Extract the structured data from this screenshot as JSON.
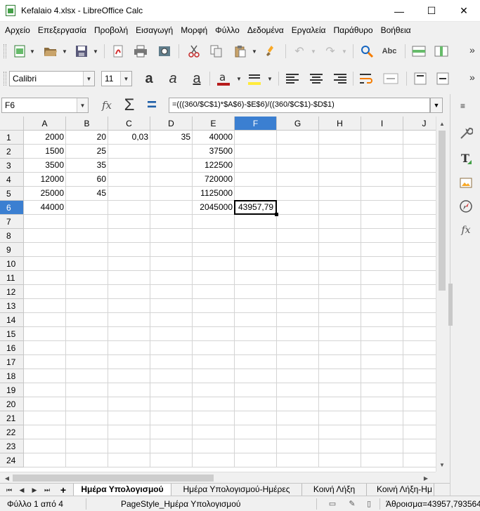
{
  "window": {
    "title": "Kefalaio 4.xlsx - LibreOffice Calc",
    "minimize": "—",
    "maximize": "☐",
    "close": "✕"
  },
  "menu": [
    "Αρχείο",
    "Επεξεργασία",
    "Προβολή",
    "Εισαγωγή",
    "Μορφή",
    "Φύλλο",
    "Δεδομένα",
    "Εργαλεία",
    "Παράθυρο",
    "Βοήθεια"
  ],
  "toolbar": {
    "font_name": "Calibri",
    "font_size": "11",
    "more": "»"
  },
  "formula_bar": {
    "name_box": "F6",
    "formula": "=(((360/$C$1)*$A$6)-$E$6)/((360/$C$1)-$D$1)",
    "fx": "fx",
    "sum": "Σ",
    "equals": "="
  },
  "grid": {
    "columns": [
      "A",
      "B",
      "C",
      "D",
      "E",
      "F",
      "G",
      "H",
      "I",
      "J"
    ],
    "rows": [
      "1",
      "2",
      "3",
      "4",
      "5",
      "6",
      "7",
      "8",
      "9",
      "10",
      "11",
      "12",
      "13",
      "14",
      "15",
      "16",
      "17",
      "18",
      "19",
      "20",
      "21",
      "22",
      "23",
      "24"
    ],
    "active_column": "F",
    "active_row": "6",
    "cells": {
      "A1": "2000",
      "B1": "20",
      "C1": "0,03",
      "D1": "35",
      "E1": "40000",
      "A2": "1500",
      "B2": "25",
      "E2": "37500",
      "A3": "3500",
      "B3": "35",
      "E3": "122500",
      "A4": "12000",
      "B4": "60",
      "E4": "720000",
      "A5": "25000",
      "B5": "45",
      "E5": "1125000",
      "A6": "44000",
      "E6": "2045000",
      "F6": "43957,79"
    }
  },
  "sheets": {
    "tabs": [
      "Ημέρα Υπολογισμού",
      "Ημέρα Υπολογισμού-Ημέρες",
      "Κοινή Λήξη",
      "Κοινή Λήξη-Ημ"
    ],
    "active": 0,
    "add": "+"
  },
  "status": {
    "sheet_info": "Φύλλο 1 από 4",
    "page_style": "PageStyle_Ημέρα Υπολογισμού",
    "sum": "Άθροισμα=43957,793564"
  }
}
